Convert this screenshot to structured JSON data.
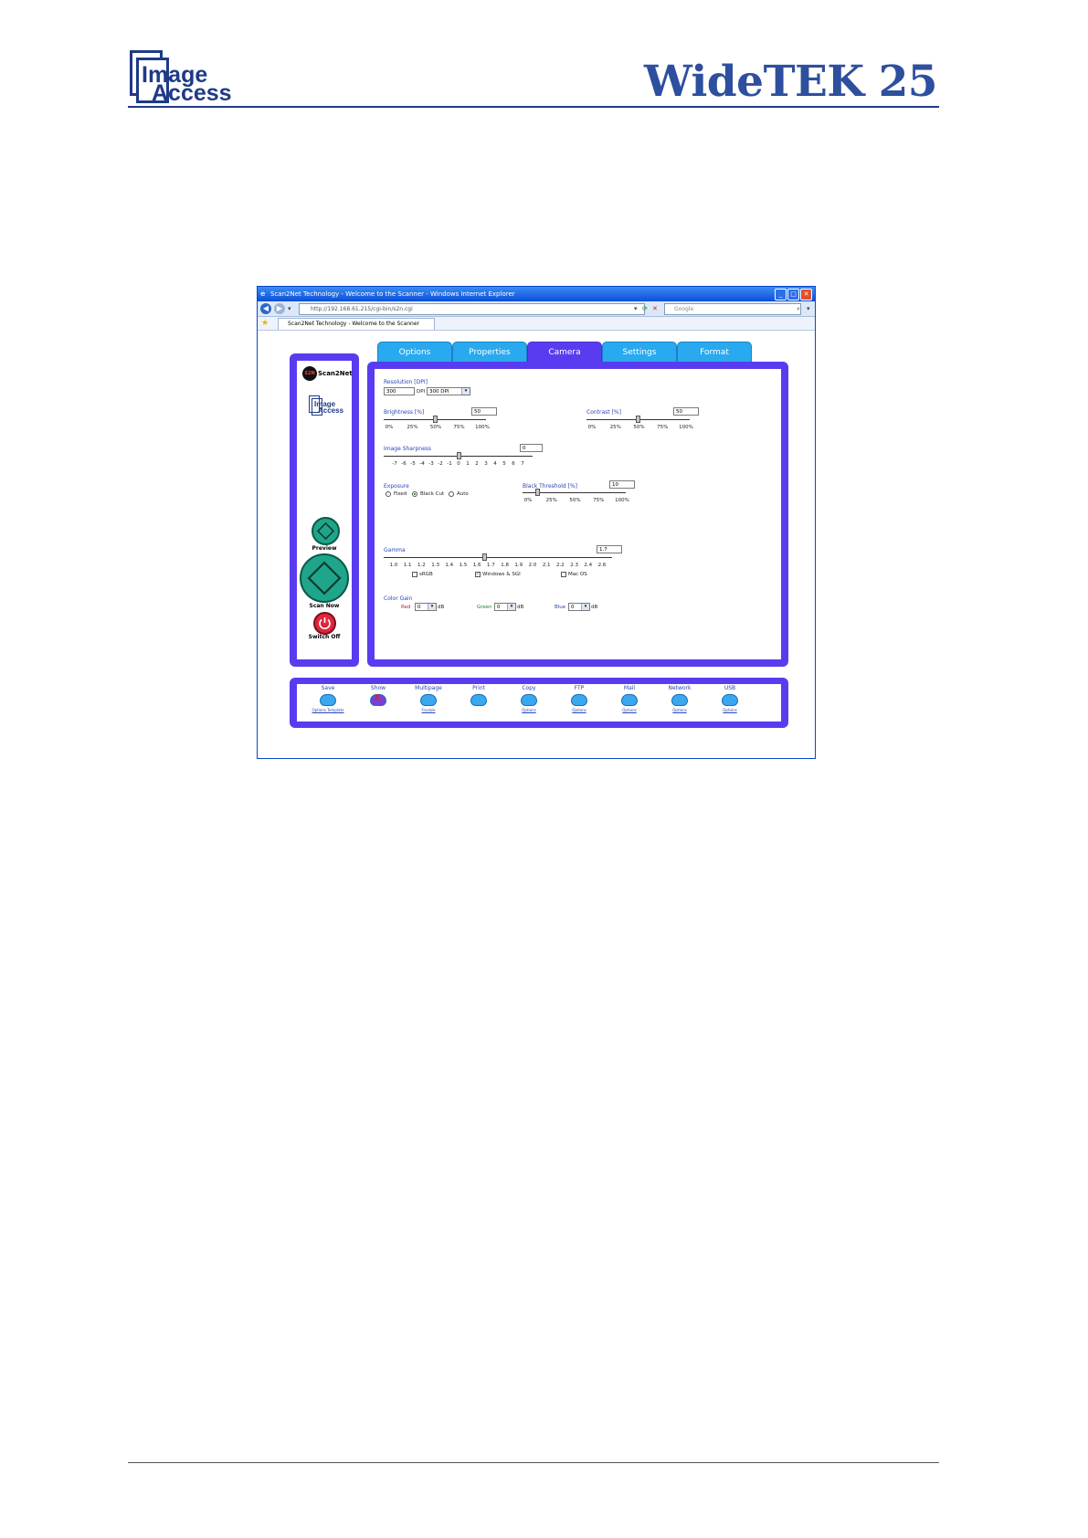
{
  "page_header": {
    "logo_line1": "Image",
    "logo_line2": "Access",
    "product_title": "WideTEK 25"
  },
  "browser": {
    "title": "Scan2Net Technology - Welcome to the Scanner - Windows Internet Explorer",
    "address": "http://192.168.61.215/cgi-bin/s2n.cgi",
    "search_placeholder": "Google",
    "tab_title": "Scan2Net Technology - Welcome to the Scanner"
  },
  "app": {
    "brand": "Scan2Net",
    "brand_badge": "S2N",
    "sidebar_logo_line1": "Image",
    "sidebar_logo_line2": "Access",
    "tabs": [
      "Options",
      "Properties",
      "Camera",
      "Settings",
      "Format"
    ],
    "active_tab": "Camera",
    "buttons": {
      "preview": "Preview",
      "scan_now": "Scan Now",
      "switch_off": "Switch Off"
    }
  },
  "camera": {
    "resolution": {
      "label": "Resolution [DPI]",
      "value": "300",
      "unit": "DPI",
      "select": "300 DPI"
    },
    "brightness": {
      "label": "Brightness [%]",
      "value": "50",
      "level": 0.5,
      "ticks": [
        "0%",
        "25%",
        "50%",
        "75%",
        "100%"
      ]
    },
    "contrast": {
      "label": "Contrast [%]",
      "value": "50",
      "level": 0.5,
      "ticks": [
        "0%",
        "25%",
        "50%",
        "75%",
        "100%"
      ]
    },
    "sharpness": {
      "label": "Image Sharpness",
      "value": "0",
      "level": 0.5,
      "ticks": [
        "-7",
        "-6",
        "-5",
        "-4",
        "-3",
        "-2",
        "-1",
        "0",
        "1",
        "2",
        "3",
        "4",
        "5",
        "6",
        "7"
      ]
    },
    "exposure": {
      "label": "Exposure",
      "options": [
        "Fixed",
        "Black Cut",
        "Auto"
      ],
      "selected": "Black Cut"
    },
    "black_threshold": {
      "label": "Black Threshold [%]",
      "value": "10",
      "level": 0.1,
      "ticks": [
        "0%",
        "25%",
        "50%",
        "75%",
        "100%"
      ]
    },
    "gamma": {
      "label": "Gamma",
      "value": "1.7",
      "level": 0.4375,
      "ticks": [
        "1.0",
        "1.1",
        "1.2",
        "1.3",
        "1.4",
        "1.5",
        "1.6",
        "1.7",
        "1.8",
        "1.9",
        "2.0",
        "2.1",
        "2.2",
        "2.3",
        "2.4",
        "2.6"
      ],
      "presets": [
        {
          "label": "sRGB",
          "checked": false
        },
        {
          "label": "Windows & SGI",
          "checked": true
        },
        {
          "label": "Mac OS",
          "checked": false
        }
      ]
    },
    "color_gain": {
      "label": "Color Gain",
      "red_label": "Red",
      "red_value": "0",
      "green_label": "Green",
      "green_value": "0",
      "blue_label": "Blue",
      "blue_value": "0",
      "unit": "dB"
    }
  },
  "destinations": [
    {
      "label": "Save",
      "sub": "Options Template"
    },
    {
      "label": "Show",
      "sub": ""
    },
    {
      "label": "Multipage",
      "sub": "Finalize"
    },
    {
      "label": "Print",
      "sub": ""
    },
    {
      "label": "Copy",
      "sub": "Options"
    },
    {
      "label": "FTP",
      "sub": "Options"
    },
    {
      "label": "Mail",
      "sub": "Options"
    },
    {
      "label": "Network",
      "sub": "Options"
    },
    {
      "label": "USB",
      "sub": "Options"
    }
  ],
  "colors": {
    "panel_violet": "#5a3cf0",
    "tab_blue": "#29a9ee",
    "label_blue": "#2745b5",
    "header_navy": "#1f3a86"
  }
}
